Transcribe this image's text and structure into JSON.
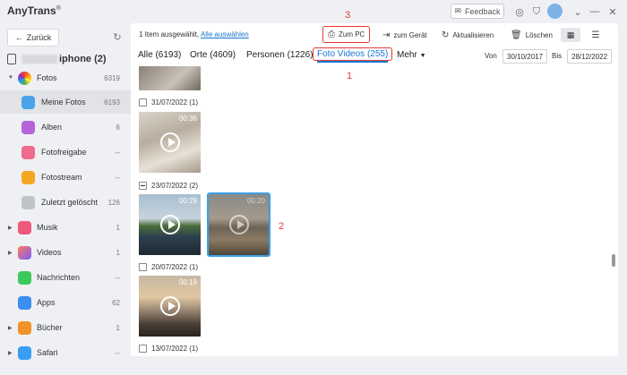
{
  "app": {
    "title": "AnyTrans",
    "reg_mark": "®"
  },
  "titlebar": {
    "feedback_label": "Feedback"
  },
  "sidebar": {
    "back_label": "Zurück",
    "device_name": "iphone (2)",
    "items": [
      {
        "label": "Fotos",
        "count": "6319",
        "expandable": true,
        "icon": "photos-icon"
      },
      {
        "label": "Meine Fotos",
        "count": "6193",
        "active": true,
        "icon": "my-photos-icon"
      },
      {
        "label": "Alben",
        "count": "6",
        "icon": "albums-icon"
      },
      {
        "label": "Fotofreigabe",
        "count": "--",
        "icon": "photo-sharing-icon"
      },
      {
        "label": "Fotostream",
        "count": "--",
        "icon": "photostream-icon"
      },
      {
        "label": "Zuletzt gelöscht",
        "count": "126",
        "icon": "trash-icon"
      },
      {
        "label": "Musik",
        "count": "1",
        "expandable": true,
        "icon": "music-icon"
      },
      {
        "label": "Videos",
        "count": "1",
        "expandable": true,
        "icon": "videos-icon"
      },
      {
        "label": "Nachrichten",
        "count": "--",
        "icon": "messages-icon"
      },
      {
        "label": "Apps",
        "count": "62",
        "icon": "apps-icon"
      },
      {
        "label": "Bücher",
        "count": "1",
        "expandable": true,
        "icon": "books-icon"
      },
      {
        "label": "Safari",
        "count": "--",
        "expandable": true,
        "icon": "safari-icon"
      }
    ]
  },
  "toolbar": {
    "selection_text": "1 Item ausgewählt,",
    "select_all": "Alle auswählen",
    "to_pc": "Zum PC",
    "to_device": "zum Gerät",
    "refresh": "Aktualisieren",
    "delete": "Löschen"
  },
  "tabs": {
    "all": "Alle (6193)",
    "places": "Orte (4609)",
    "people": "Personen (1226)",
    "videos": "Foto Videos (255)",
    "more": "Mehr"
  },
  "date_filter": {
    "from_label": "Von",
    "from": "30/10/2017",
    "to_label": "Bis",
    "to": "28/12/2022"
  },
  "annotations": {
    "a1": "1",
    "a2": "2",
    "a3": "3"
  },
  "groups": [
    {
      "date": "31/07/2022 (1)"
    },
    {
      "date": "23/07/2022 (2)"
    },
    {
      "date": "20/07/2022 (1)"
    },
    {
      "date": "13/07/2022 (1)"
    }
  ],
  "videos": [
    {
      "duration": "00:36"
    },
    {
      "duration": "00:29"
    },
    {
      "duration": "00:20"
    },
    {
      "duration": "00:19"
    }
  ],
  "colors": {
    "accent": "#1976d2",
    "annotation": "#e53935",
    "selection": "#3aa0e8"
  }
}
